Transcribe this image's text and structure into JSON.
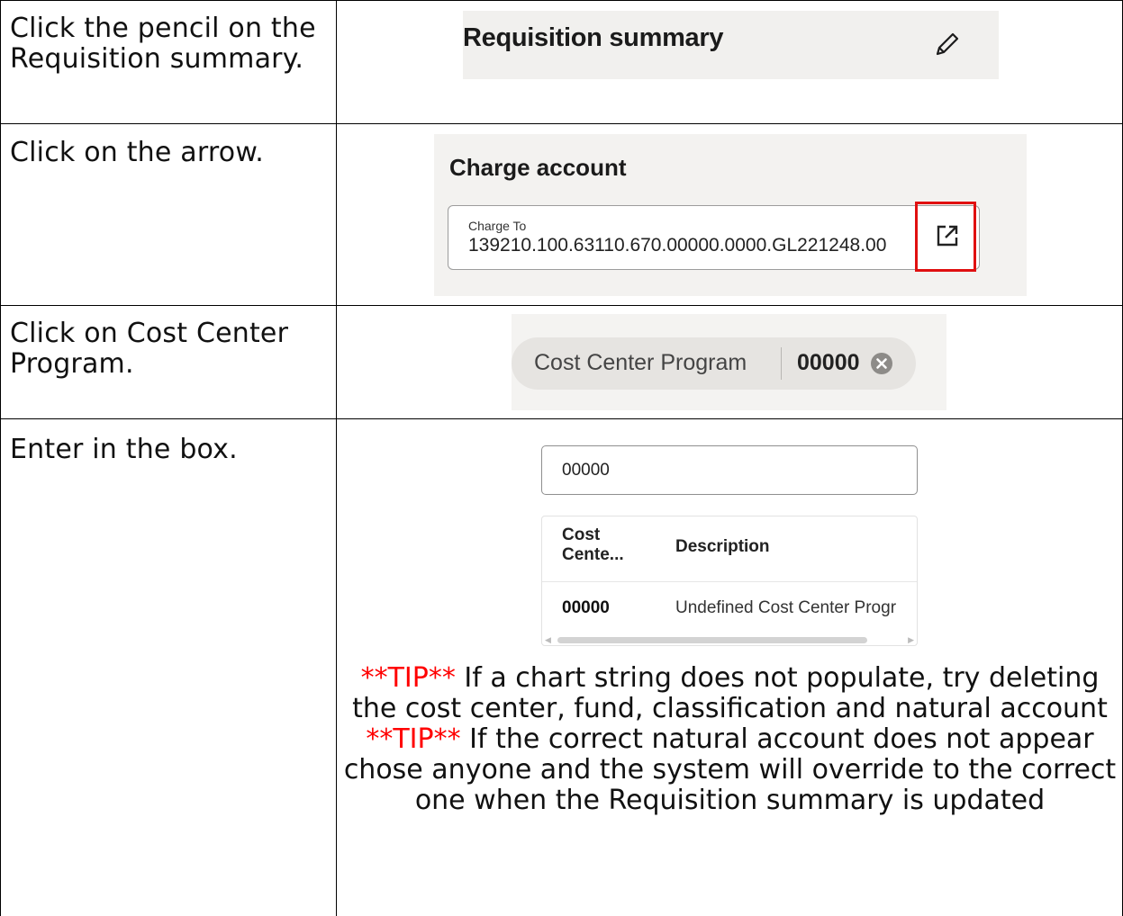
{
  "steps": [
    {
      "instruction": "Click the pencil on the Requisition summary."
    },
    {
      "instruction": "Click on the arrow."
    },
    {
      "instruction": "Click on Cost Center Program."
    },
    {
      "instruction": "Enter in the box."
    }
  ],
  "requisition_summary": {
    "title": "Requisition summary",
    "icon": "pencil-icon"
  },
  "charge_account": {
    "title": "Charge account",
    "field_label": "Charge To",
    "field_value": "139210.100.63110.670.00000.0000.GL221248.00",
    "icon": "external-link-icon",
    "highlight_color": "#e01010"
  },
  "cost_center_chip": {
    "label": "Cost Center Program",
    "value": "00000",
    "icon": "clear-icon"
  },
  "search": {
    "value": "00000"
  },
  "results_table": {
    "headers": [
      "Cost Cente...",
      "Description"
    ],
    "rows": [
      {
        "code": "00000",
        "description": "Undefined Cost Center Progr"
      }
    ]
  },
  "tips": [
    {
      "marker": "**TIP**",
      "text": "If a chart string does not populate, try deleting the cost center, fund, classification and natural account"
    },
    {
      "marker": "**TIP**",
      "text": "If the correct natural account does not appear chose anyone and the system will override to the correct one when the Requisition summary is updated"
    }
  ],
  "colors": {
    "tip_marker": "#ff0000",
    "panel_background": "#f1f0ee"
  }
}
